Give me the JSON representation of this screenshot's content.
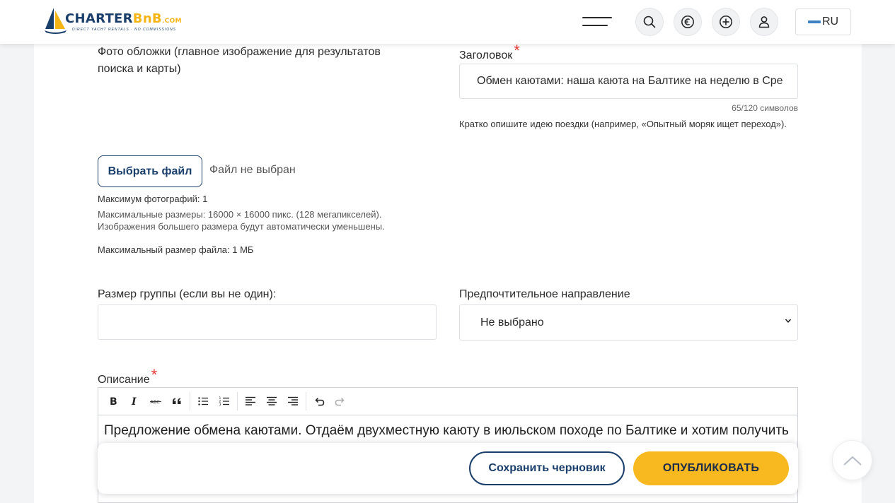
{
  "header": {
    "logo": {
      "word_a": "CHARTER",
      "word_b": "BnB",
      "domain": ".COM",
      "tagline": "DIRECT YACHT RENTALS · NO COMMISSIONS"
    },
    "icons": [
      "menu-icon",
      "search-icon",
      "euro-icon",
      "add-icon",
      "user-icon"
    ],
    "language": "RU"
  },
  "form": {
    "cover_photo": {
      "label": "Фото обложки (главное изображение для результатов поиска и карты)",
      "choose_button": "Выбрать файл",
      "no_file": "Файл не выбран",
      "max_photos": "Максимум фотографий: 1",
      "max_dims": "Максимальные размеры: 16000 × 16000 пикс. (128 мегапикселей). Изображения большего размера будут автоматически уменьшены.",
      "max_size": "Максимальный размер файла: 1 МБ"
    },
    "title": {
      "label": "Заголовок",
      "required_mark": "*",
      "value": "Обмен каютами: наша каюта на Балтике на неделю в Сре",
      "counter": "65/120 символов",
      "hint": "Кратко опишите идею поездки (например, «Опытный моряк ищет переход»)."
    },
    "group_size": {
      "label": "Размер группы (если вы не один):",
      "value": ""
    },
    "direction": {
      "label": "Предпочтительное направление",
      "selected": "Не выбрано"
    },
    "description": {
      "label": "Описание",
      "required_mark": "*",
      "toolbar": [
        "bold-icon",
        "italic-icon",
        "strikethrough-icon",
        "quote-icon",
        "bullet-list-icon",
        "numbered-list-icon",
        "align-left-icon",
        "align-center-icon",
        "align-right-icon",
        "undo-icon",
        "redo-icon"
      ],
      "text": "Предложение обмена каютами. Отдаём двухместную каюту в июльском походе по Балтике и хотим получить"
    }
  },
  "actions": {
    "save_draft": "Сохранить черновик",
    "publish": "ОПУБЛИКОВАТЬ"
  },
  "colors": {
    "navy": "#1b3f6b",
    "accent": "#f7b91f",
    "required": "#e53935"
  }
}
